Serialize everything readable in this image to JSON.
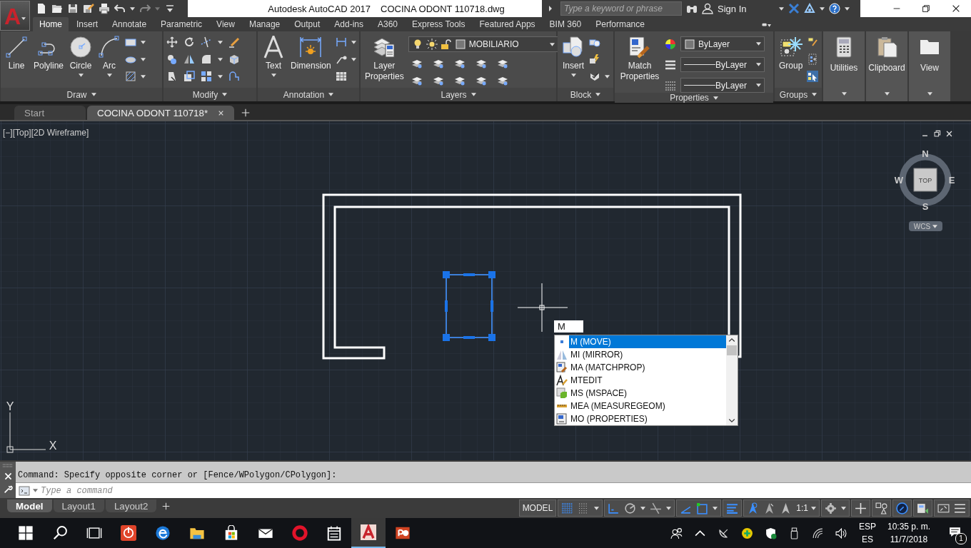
{
  "app_menu": {
    "logo": "A"
  },
  "title_bar": {
    "app_name": "Autodesk AutoCAD 2017",
    "file_name": "COCINA ODONT 110718.dwg",
    "search": {
      "placeholder": "Type a keyword or phrase"
    },
    "sign_in": "Sign In"
  },
  "ribbon_tabs": [
    {
      "label": "Home",
      "selected": true
    },
    {
      "label": "Insert",
      "selected": false
    },
    {
      "label": "Annotate",
      "selected": false
    },
    {
      "label": "Parametric",
      "selected": false
    },
    {
      "label": "View",
      "selected": false
    },
    {
      "label": "Manage",
      "selected": false
    },
    {
      "label": "Output",
      "selected": false
    },
    {
      "label": "Add-ins",
      "selected": false
    },
    {
      "label": "A360",
      "selected": false
    },
    {
      "label": "Express Tools",
      "selected": false
    },
    {
      "label": "Featured Apps",
      "selected": false
    },
    {
      "label": "BIM 360",
      "selected": false
    },
    {
      "label": "Performance",
      "selected": false
    }
  ],
  "ribbon": {
    "draw": {
      "title": "Draw",
      "tools": [
        "Line",
        "Polyline",
        "Circle",
        "Arc"
      ]
    },
    "modify": {
      "title": "Modify"
    },
    "annotation": {
      "title": "Annotation",
      "tools": [
        "Text",
        "Dimension"
      ]
    },
    "layers": {
      "title": "Layers",
      "tool": "Layer Properties",
      "current_layer": "MOBILIARIO"
    },
    "block": {
      "title": "Block",
      "tool": "Insert"
    },
    "properties": {
      "title": "Properties",
      "tool": "Match Properties",
      "object_setting": "ByLayer",
      "linetype": "ByLayer",
      "lineweight": "ByLayer"
    },
    "groups": {
      "title": "Groups",
      "tool": "Group"
    },
    "utilities": "Utilities",
    "clipboard": "Clipboard",
    "view": "View"
  },
  "file_tabs": [
    {
      "label": "Start",
      "selected": false
    },
    {
      "label": "COCINA ODONT 110718*",
      "selected": true
    }
  ],
  "viewport": {
    "label": "[−][Top][2D Wireframe]",
    "viewcube": {
      "north": "N",
      "south": "S",
      "east": "E",
      "west": "W",
      "face": "TOP",
      "ucs_menu": "WCS"
    },
    "ucs_icon": {
      "x": "X",
      "y": "Y"
    },
    "dynamic_input": "M",
    "suggestions": [
      {
        "label": "M (MOVE)",
        "kind": "move",
        "selected": true
      },
      {
        "label": "MI (MIRROR)",
        "kind": "mirror",
        "selected": false
      },
      {
        "label": "MA (MATCHPROP)",
        "kind": "matchprop",
        "selected": false
      },
      {
        "label": "MTEDIT",
        "kind": "mtedit",
        "selected": false
      },
      {
        "label": "MS (MSPACE)",
        "kind": "mspace",
        "selected": false
      },
      {
        "label": "MEA (MEASUREGEOM)",
        "kind": "measuregeom",
        "selected": false
      },
      {
        "label": "MO (PROPERTIES)",
        "kind": "properties",
        "selected": false
      }
    ]
  },
  "command_line": {
    "history": "Command: Specify opposite corner or [Fence/WPolygon/CPolygon]:",
    "placeholder": "Type a command"
  },
  "layout_tabs": [
    {
      "label": "Model",
      "selected": true
    },
    {
      "label": "Layout1",
      "selected": false
    },
    {
      "label": "Layout2",
      "selected": false
    }
  ],
  "status_bar": {
    "space": "MODEL",
    "scale": "1:1"
  },
  "taskbar": {
    "language": "ESP",
    "keyboard": "ES",
    "time": "10:35 p. m.",
    "date": "11/7/2018",
    "notifications": "1"
  }
}
